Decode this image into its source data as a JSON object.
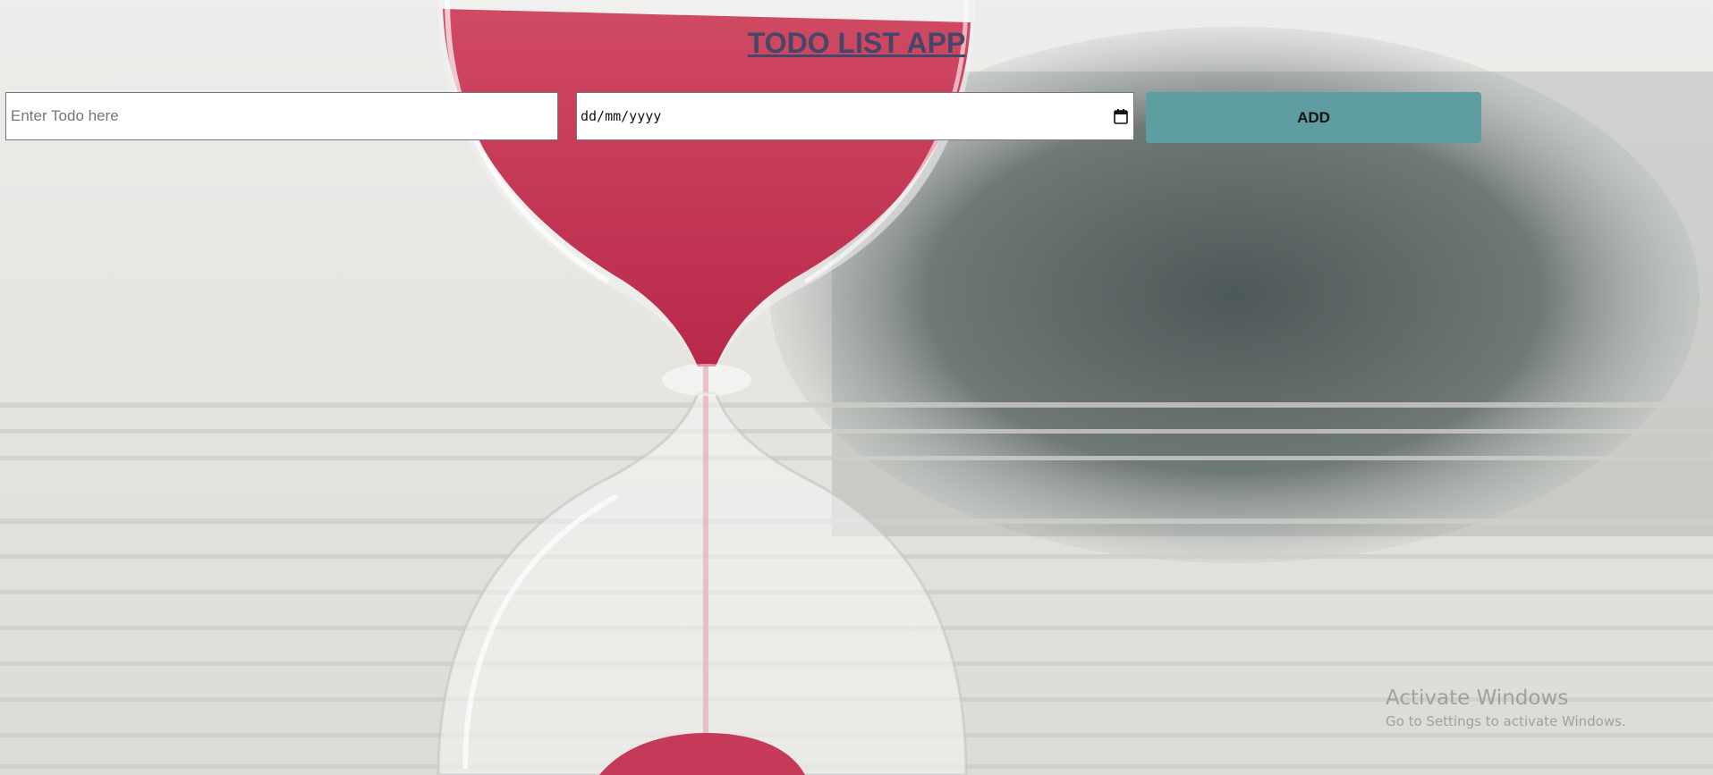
{
  "header": {
    "title": "TODO LIST APP"
  },
  "form": {
    "todo_placeholder": "Enter Todo here",
    "date_value": "dd/mm/yyyy",
    "add_label": "ADD"
  },
  "icons": {
    "calendar": "calendar-icon"
  },
  "watermark": {
    "title": "Activate Windows",
    "subtitle": "Go to Settings to activate Windows."
  },
  "colors": {
    "title": "#44476a",
    "add_button": "#5f9ea0",
    "sand": "#c4344f"
  }
}
